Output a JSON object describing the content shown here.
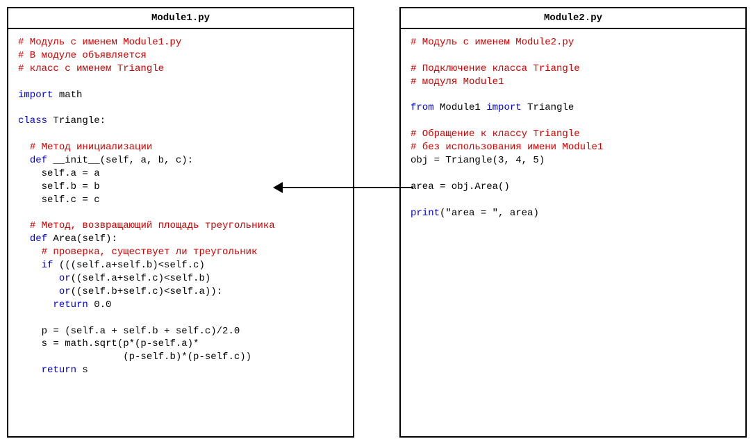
{
  "module1": {
    "title": "Module1.py",
    "comments": {
      "header1": "# Модуль с именем Module1.py",
      "header2": "# В модуле объявляется",
      "header3": "# класс с именем Triangle",
      "init_comment": "# Метод инициализации",
      "area_comment": "# Метод, возвращающий площадь треугольника",
      "check_comment": "# проверка, существует ли треугольник"
    },
    "kw": {
      "import": "import",
      "class": "class",
      "def1": "def",
      "def2": "def",
      "if": "if",
      "or1": "or",
      "or2": "or",
      "return1": "return",
      "return2": "return"
    },
    "text": {
      "import_rest": " math",
      "class_rest": " Triangle:",
      "init_sig": " __init__(self, a, b, c):",
      "init_b1": "self.a = a",
      "init_b2": "self.b = b",
      "init_b3": "self.c = c",
      "area_sig": " Area(self):",
      "if_rest": " (((self.a+self.b)<self.c)",
      "or1_rest": "((self.a+self.c)<self.b)",
      "or2_rest": "((self.b+self.c)<self.a)):",
      "return1_rest": " 0.0",
      "p_line": "p = (self.a + self.b + self.c)/2.0",
      "s_line1": "s = math.sqrt(p*(p-self.a)*",
      "s_line2": "              (p-self.b)*(p-self.c))",
      "return2_rest": " s"
    }
  },
  "module2": {
    "title": "Module2.py",
    "comments": {
      "header1": "# Модуль с именем Module2.py",
      "conn1": "# Подключение класса Triangle",
      "conn2": "# модуля Module1",
      "usage1": "# Обращение к классу Triangle",
      "usage2": "# без использования имени Module1"
    },
    "kw": {
      "from": "from",
      "import": "import",
      "print": "print"
    },
    "text": {
      "from_mid": " Module1 ",
      "import_rest": " Triangle",
      "obj_line": "obj = Triangle(3, 4, 5)",
      "area_line": "area = obj.Area()",
      "print_rest": "(\"area = \", area)"
    }
  }
}
